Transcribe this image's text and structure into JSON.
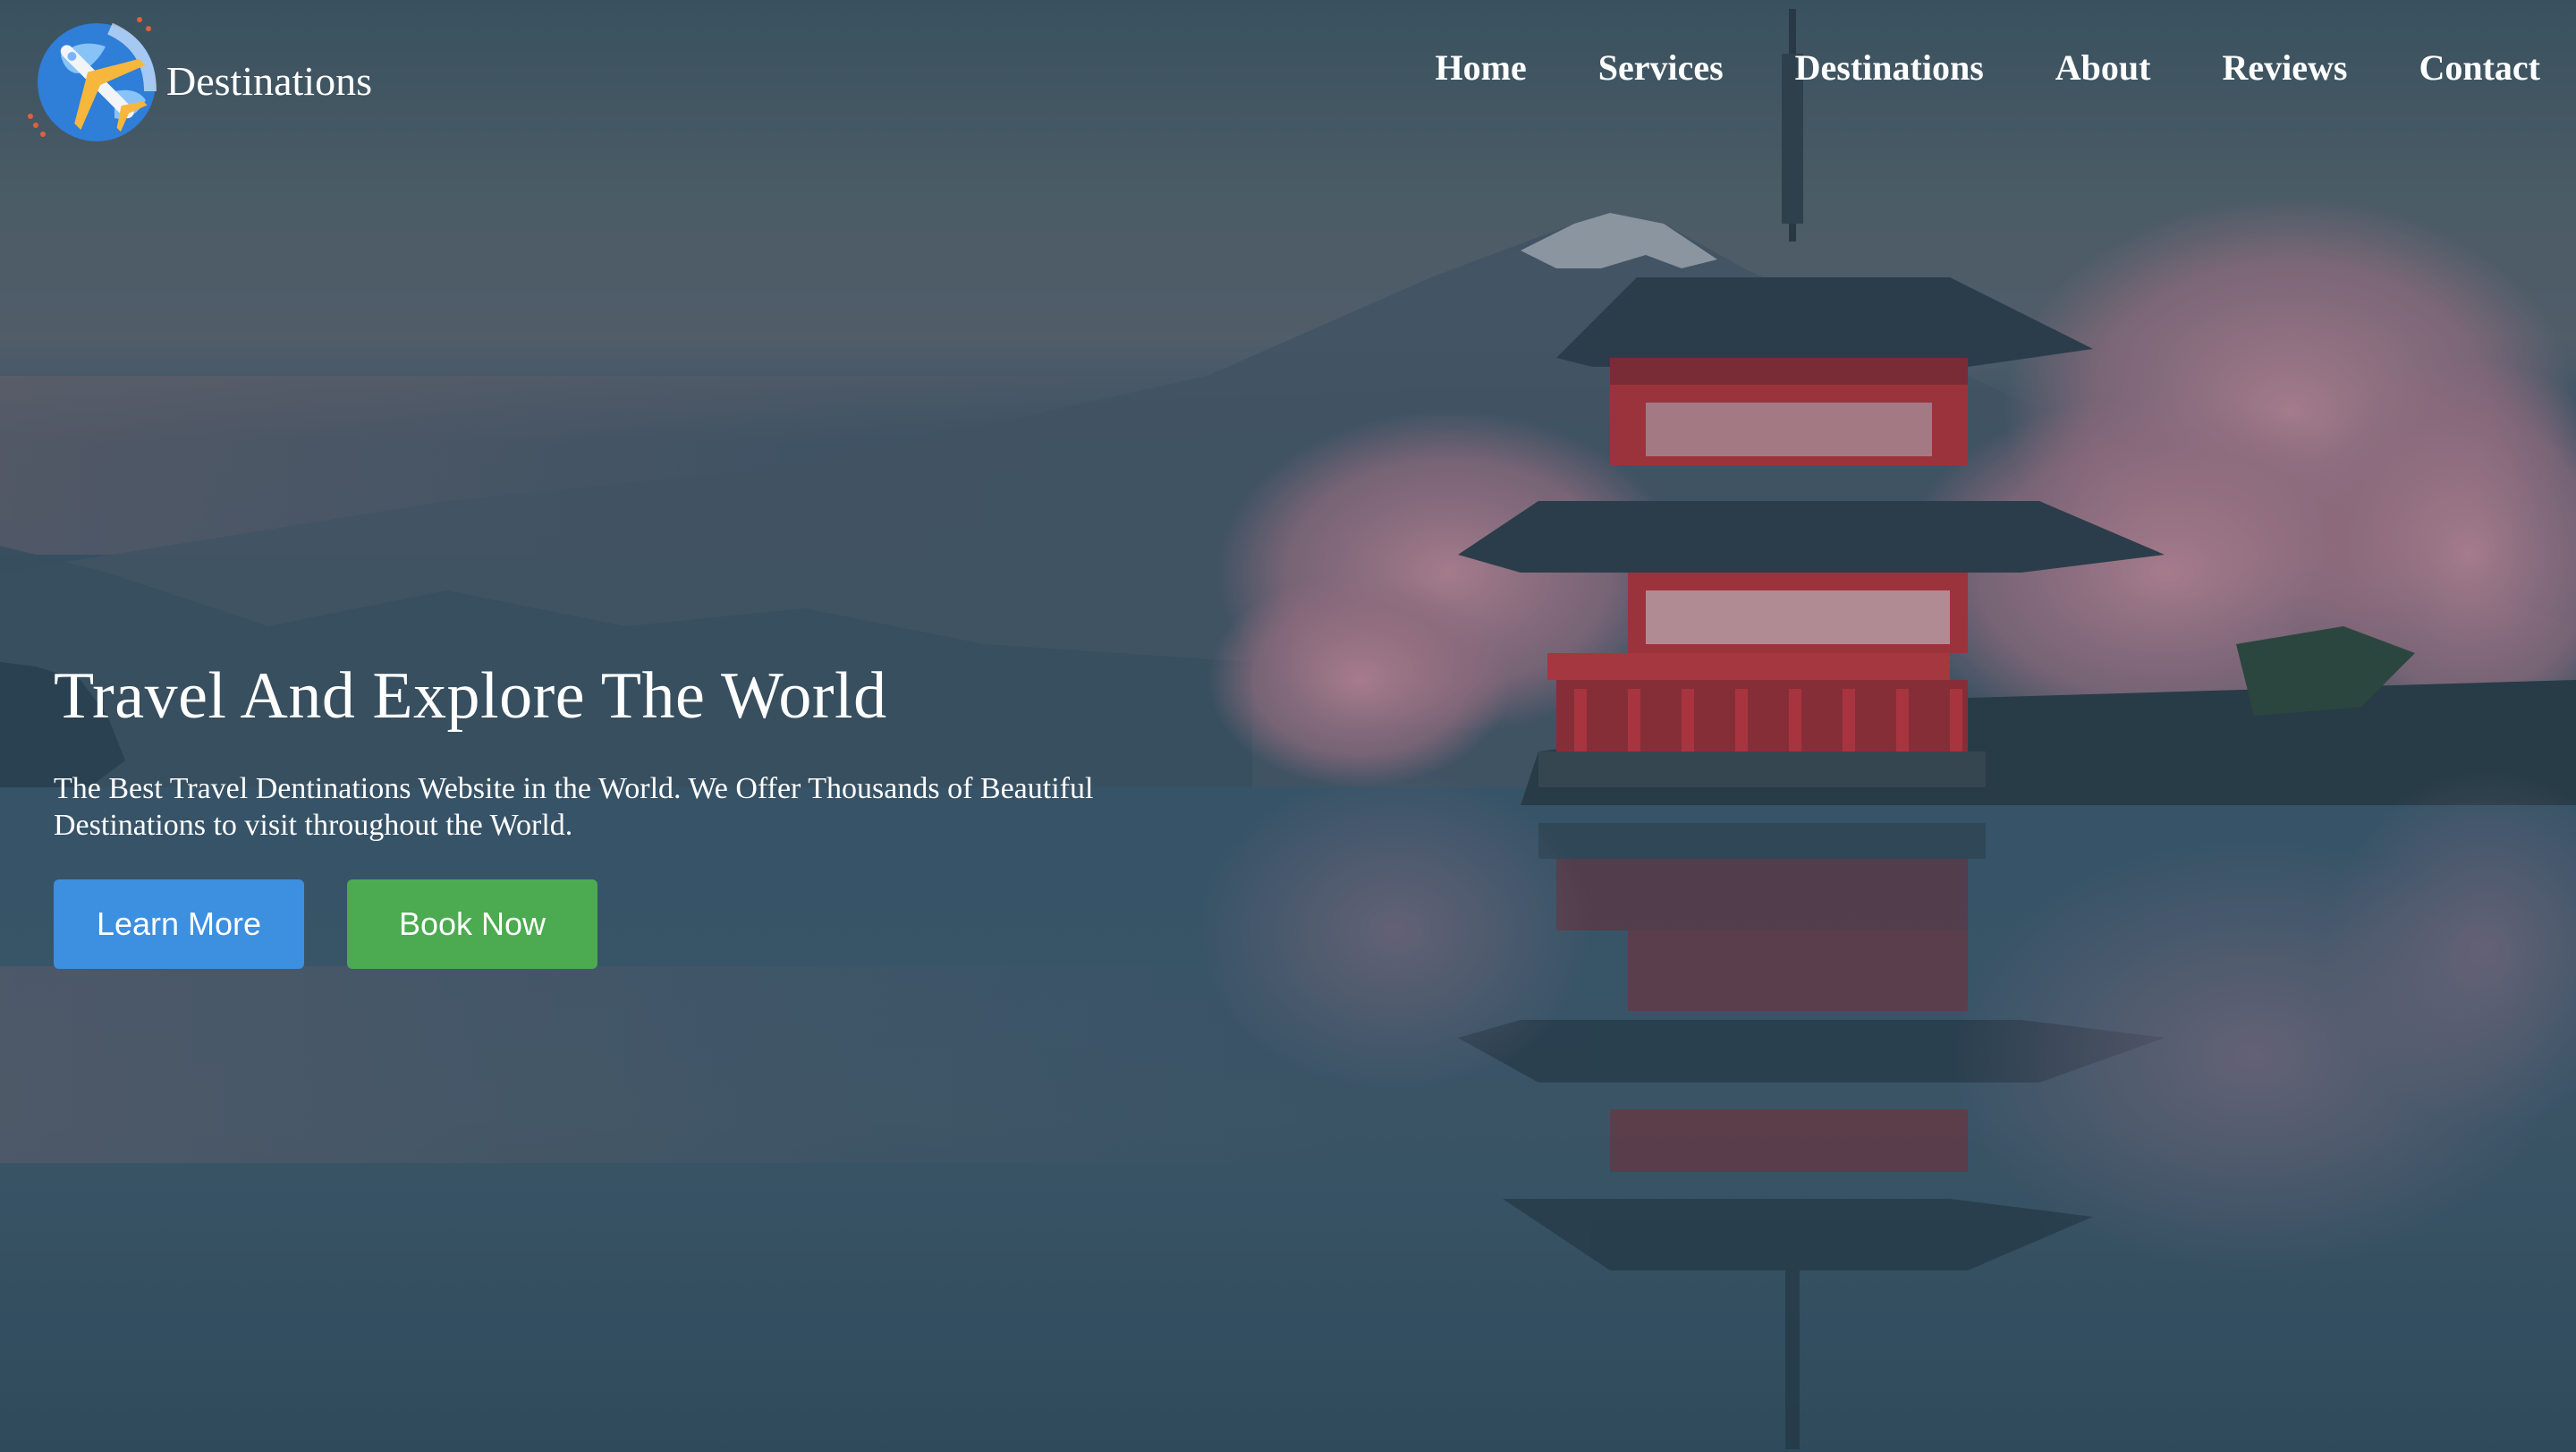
{
  "brand": {
    "name": "Destinations",
    "logo_icon": "globe-airplane-icon"
  },
  "nav": {
    "items": [
      {
        "label": "Home"
      },
      {
        "label": "Services"
      },
      {
        "label": "Destinations"
      },
      {
        "label": "About"
      },
      {
        "label": "Reviews"
      },
      {
        "label": "Contact"
      }
    ]
  },
  "hero": {
    "title": "Travel And Explore The World",
    "subtitle": "The Best Travel Dentinations Website in the World. We Offer Thousands of Beautiful Destinations to visit throughout the World.",
    "learn_more_label": "Learn More",
    "book_now_label": "Book Now"
  },
  "colors": {
    "learn_more_button": "#3d8fe0",
    "book_now_button": "#4caa50",
    "text": "#ffffff"
  }
}
